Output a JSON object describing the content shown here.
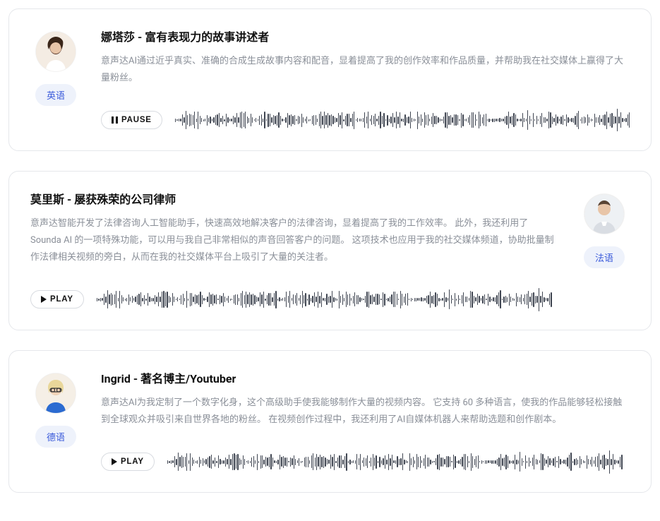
{
  "controls": {
    "play_label": "PLAY",
    "pause_label": "PAUSE"
  },
  "testimonials": [
    {
      "title": "娜塔莎 - 富有表现力的故事讲述者",
      "description": "意声达AI通过近乎真实、准确的合成生成故事内容和配音，显着提高了我的创作效率和作品质量，并帮助我在社交媒体上赢得了大量粉丝。",
      "language": "英语",
      "avatar_side": "left",
      "playing": true
    },
    {
      "title": "莫里斯 - 屡获殊荣的公司律师",
      "description": "意声达智能开发了法律咨询人工智能助手，快速高效地解决客户的法律咨询，显着提高了我的工作效率。 此外，我还利用了 Sounda AI 的一项特殊功能，可以用与我自己非常相似的声音回答客户的问题。 这项技术也应用于我的社交媒体频道，协助批量制作法律相关视频的旁白，从而在我的社交媒体平台上吸引了大量的关注者。",
      "language": "法语",
      "avatar_side": "right",
      "playing": false
    },
    {
      "title": "Ingrid - 著名博主/Youtuber",
      "description": "意声达AI为我定制了一个数字化身，这个高级助手使我能够制作大量的视频内容。 它支持 60 多种语言，使我的作品能够轻松接触到全球观众并吸引来自世界各地的粉丝。 在视频创作过程中，我还利用了AI自媒体机器人来帮助选题和创作剧本。",
      "language": "德语",
      "avatar_side": "left",
      "playing": false
    }
  ]
}
